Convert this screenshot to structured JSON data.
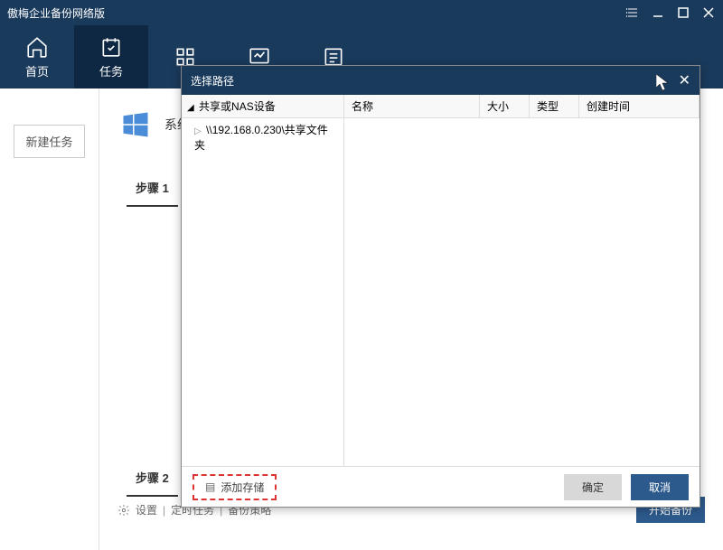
{
  "titlebar": {
    "title": "傲梅企业备份网络版"
  },
  "nav": {
    "home": "首页",
    "tasks": "任务"
  },
  "sidebar": {
    "new_task": "新建任务"
  },
  "main": {
    "system_label": "系统",
    "step1": "步骤 1",
    "step2": "步骤 2"
  },
  "footer": {
    "settings": "设置",
    "scheduled_tasks": "定时任务",
    "backup_policy": "备份策略",
    "start_backup": "开始备份"
  },
  "modal": {
    "title": "选择路径",
    "tree_header": "共享或NAS设备",
    "tree_item": "\\\\192.168.0.230\\共享文件夹",
    "columns": {
      "name": "名称",
      "size": "大小",
      "type": "类型",
      "time": "创建时间"
    },
    "add_storage": "添加存储",
    "ok": "确定",
    "cancel": "取消"
  }
}
